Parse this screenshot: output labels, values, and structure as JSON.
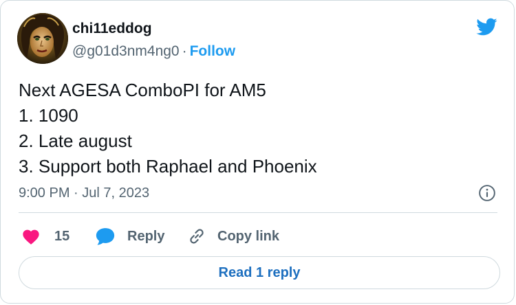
{
  "author": {
    "display_name": "chi11eddog",
    "handle": "@g01d3nm4ng0",
    "separator": "·",
    "follow_label": "Follow"
  },
  "tweet": {
    "lines": [
      "Next AGESA ComboPI for AM5",
      "1. 1090",
      "2. Late august",
      "3. Support both Raphael and Phoenix"
    ],
    "timestamp": "9:00 PM · Jul 7, 2023"
  },
  "actions": {
    "like_count": "15",
    "reply_label": "Reply",
    "copy_link_label": "Copy link",
    "read_replies_label": "Read 1 reply"
  },
  "colors": {
    "brand_blue": "#1d9bf0",
    "like_pink": "#f91880",
    "reply_blue": "#1d9bf0",
    "secondary_text": "#536471",
    "border": "#cfd9de"
  },
  "icons": {
    "brand": "twitter-bird-icon",
    "like": "heart-icon",
    "reply": "speech-bubble-icon",
    "copy_link": "link-icon",
    "info": "info-icon"
  }
}
